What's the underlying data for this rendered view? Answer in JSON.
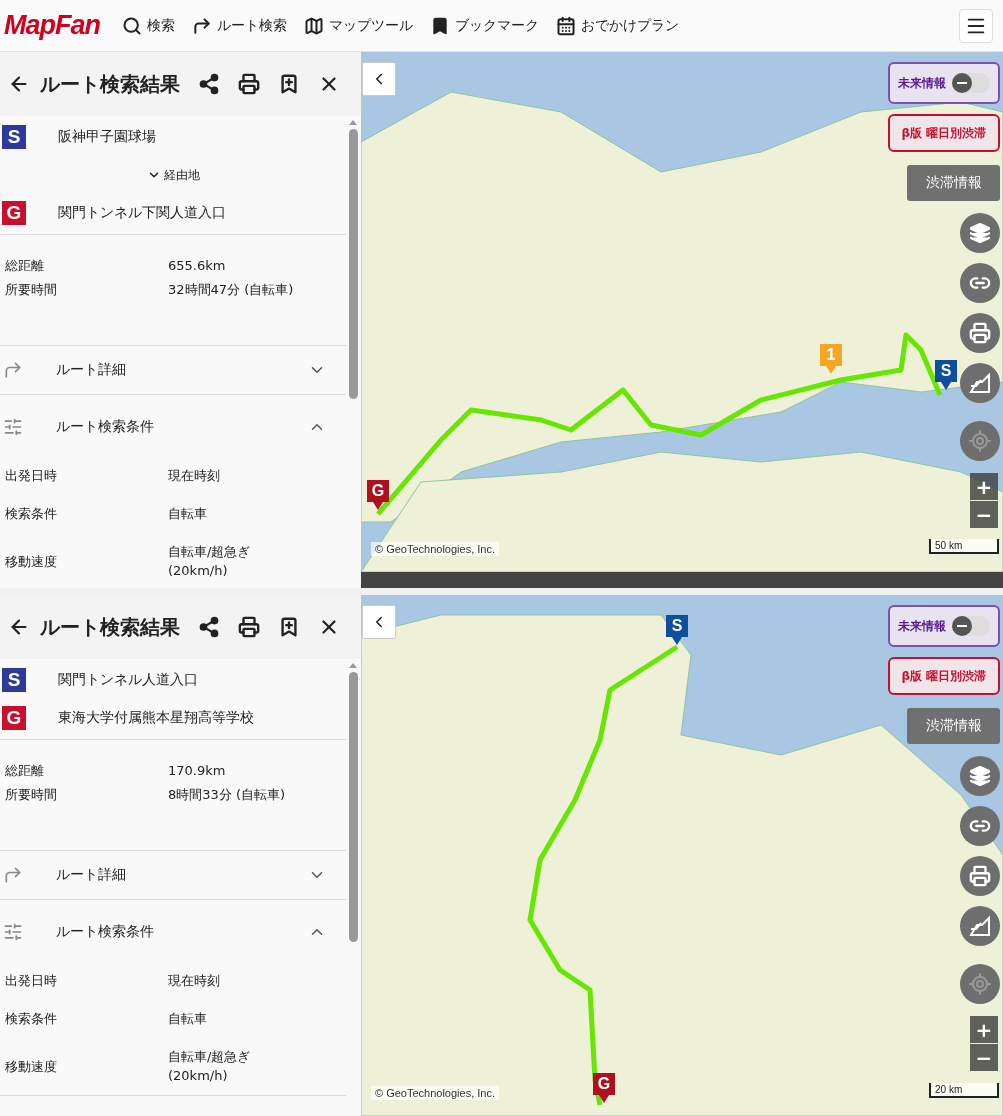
{
  "header": {
    "logo": "MapFan",
    "nav": [
      {
        "label": "検索",
        "kind": "search"
      },
      {
        "label": "ルート検索",
        "kind": "route"
      },
      {
        "label": "マップツール",
        "kind": "map"
      },
      {
        "label": "ブックマーク",
        "kind": "bookmark"
      },
      {
        "label": "おでかけプラン",
        "kind": "plan"
      }
    ]
  },
  "screens": [
    {
      "panel": {
        "title": "ルート検索結果",
        "start": {
          "badge": "S",
          "name": "阪神甲子園球場"
        },
        "via": {
          "label": "経由地",
          "expanded": false
        },
        "goal": {
          "badge": "G",
          "name": "関門トンネル下関人道入口"
        },
        "summary": [
          {
            "label": "総距離",
            "value": "655.6km"
          },
          {
            "label": "所要時間",
            "value": "32時間47分 (自転車)"
          }
        ],
        "sections": [
          {
            "kind": "detail",
            "label": "ルート詳細",
            "expanded": false
          },
          {
            "kind": "conditions",
            "label": "ルート検索条件",
            "expanded": true
          }
        ],
        "conditions": [
          {
            "label": "出発日時",
            "value": "現在時刻"
          },
          {
            "label": "検索条件",
            "value": "自転車"
          },
          {
            "label": "移動速度",
            "value": "自転車/超急ぎ\n(20km/h)"
          }
        ]
      },
      "map": {
        "future_info": {
          "label": "未来情報",
          "on": false
        },
        "weekday_traffic": "β版 曜日別渋滞",
        "traffic": "渋滞情報",
        "zoom_in": "+",
        "zoom_out": "−",
        "copyright": "© GeoTechnologies, Inc.",
        "scale": "50 km",
        "markers": [
          {
            "kind": "start",
            "label": "S"
          },
          {
            "kind": "waypoint",
            "label": "1"
          },
          {
            "kind": "goal",
            "label": "G"
          }
        ]
      }
    },
    {
      "panel": {
        "title": "ルート検索結果",
        "start": {
          "badge": "S",
          "name": "関門トンネル人道入口"
        },
        "goal": {
          "badge": "G",
          "name": "東海大学付属熊本星翔高等学校"
        },
        "summary": [
          {
            "label": "総距離",
            "value": "170.9km"
          },
          {
            "label": "所要時間",
            "value": "8時間33分 (自転車)"
          }
        ],
        "sections": [
          {
            "kind": "detail",
            "label": "ルート詳細",
            "expanded": false
          },
          {
            "kind": "conditions",
            "label": "ルート検索条件",
            "expanded": true
          }
        ],
        "conditions": [
          {
            "label": "出発日時",
            "value": "現在時刻"
          },
          {
            "label": "検索条件",
            "value": "自転車"
          },
          {
            "label": "移動速度",
            "value": "自転車/超急ぎ\n(20km/h)"
          }
        ]
      },
      "map": {
        "future_info": {
          "label": "未来情報",
          "on": false
        },
        "weekday_traffic": "β版 曜日別渋滞",
        "traffic": "渋滞情報",
        "zoom_in": "+",
        "zoom_out": "−",
        "copyright": "© GeoTechnologies, Inc.",
        "scale": "20 km",
        "markers": [
          {
            "kind": "start",
            "label": "S"
          },
          {
            "kind": "goal",
            "label": "G"
          }
        ]
      }
    }
  ]
}
